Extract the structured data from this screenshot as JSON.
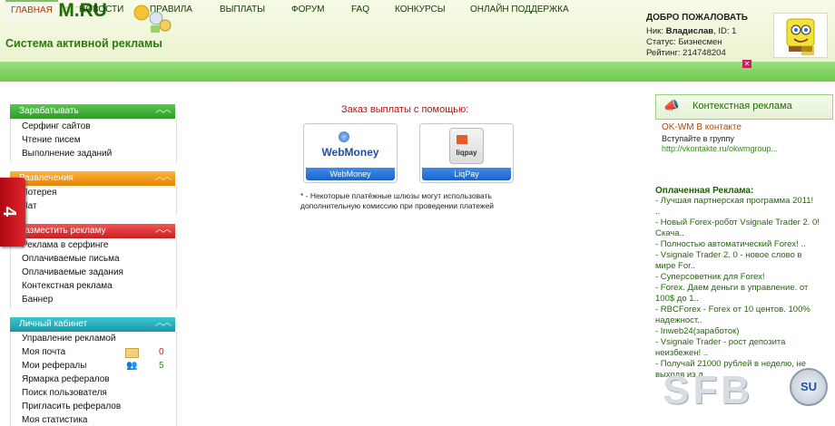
{
  "header": {
    "logo": "OK-WM.RU",
    "tagline": "Система активной рекламы",
    "welcome_title": "ДОБРО ПОЖАЛОВАТЬ",
    "nick_label": "Ник:",
    "nick": "Владислав",
    "id_label": ", ID: 1",
    "status_label": "Статус:",
    "status": "Бизнесмен",
    "rating_label": "Рейтинг:",
    "rating": "214748204"
  },
  "nav": {
    "items": [
      "ГЛАВНАЯ",
      "НОВОСТИ",
      "ПРАВИЛА",
      "ВЫПЛАТЫ",
      "ФОРУМ",
      "FAQ",
      "КОНКУРСЫ",
      "ОНЛАЙН ПОДДЕРЖКА"
    ],
    "active_index": 0
  },
  "sidebar": {
    "earn": {
      "title": "Зарабатывать",
      "items": [
        "Серфинг сайтов",
        "Чтение писем",
        "Выполнение заданий"
      ]
    },
    "fun": {
      "title": "Развлечения",
      "items": [
        "Лотерея",
        "Чат"
      ]
    },
    "advertise": {
      "title": "Разместить рекламу",
      "items": [
        "Реклама в серфинге",
        "Оплачиваемые письма",
        "Оплачиваемые задания",
        "Контекстная реклама",
        "Баннер"
      ]
    },
    "cabinet": {
      "title": "Личный кабинет",
      "items": [
        "Управление рекламой",
        "Моя почта",
        "Мои рефералы",
        "Ярмарка рефералов",
        "Поиск пользователя",
        "Пригласить рефералов",
        "Моя статистика"
      ],
      "mail_count": "0",
      "ref_count": "5"
    },
    "side_tab": "4"
  },
  "payout": {
    "title": "Заказ выплаты с помощью:",
    "methods": [
      {
        "logo": "WebMoney",
        "label": "WebMoney"
      },
      {
        "logo": "liqpay",
        "label": "LiqPay"
      }
    ],
    "note": "* - Некоторые платёжные шлюзы могут использовать дополнительную комиссию при проведении платежей"
  },
  "context_ads": {
    "title": "Контекстная реклама",
    "link_title": "OK-WM В контакте",
    "desc": "Вступайте в группу",
    "url": "http://vkontakte.ru/okwmgroup..."
  },
  "paid_ads": {
    "title": "Оплаченная Реклама:",
    "items": [
      "- Лучшая партнерская программа 2011! ..",
      "- Новый Forex-робот Vsignale Trader 2. 0! Скача..",
      "- Полностью автоматический Forex! ..",
      "- Vsignale Trader 2. 0 - новое слово в мире For..",
      "- Суперсоветник для Forex!",
      "- Forex. Даем деньги в управление. от 100$ до 1..",
      "- RBCForex - Forex от 10 центов. 100% надежност..",
      "- Inweb24(заработок)",
      "- Vsignale Trader - рост депозита неизбежен! ..",
      "- Получай 21000 рублей в неделю, не выходя из д.."
    ]
  },
  "watermark": {
    "text": "SFB",
    "suffix": "SU"
  },
  "colors": {
    "nav_green": "#6cc84c",
    "link_green": "#1f6a05",
    "accent_red": "#b8120e"
  }
}
